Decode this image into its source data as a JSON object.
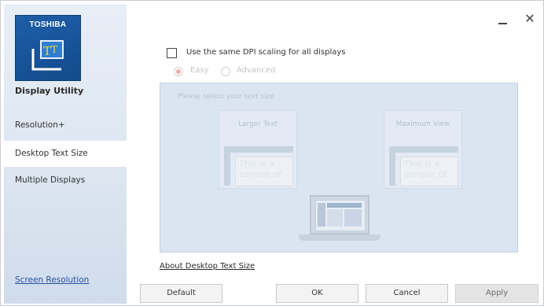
{
  "sidebar": {
    "brand": "TOSHIBA",
    "logo_glyph": "T",
    "app_name": "Display Utility",
    "items": [
      {
        "label": "Resolution+"
      },
      {
        "label": "Desktop Text Size"
      },
      {
        "label": "Multiple Displays"
      }
    ],
    "active_item": "Desktop Text Size",
    "bottom_link": "Screen Resolution"
  },
  "window_controls": {
    "minimize": "minimize-icon",
    "close_glyph": "✕"
  },
  "main": {
    "checkbox_label": "Use the same DPI scaling for all displays",
    "checkbox_checked": false,
    "radio_easy": "Easy",
    "radio_advanced": "Advanced",
    "radio_selected": "Easy",
    "panel_hint": "Please select your text size",
    "card_larger": {
      "title": "Larger Text",
      "sample": "This is a sample of"
    },
    "card_max": {
      "title": "Maximum View",
      "sample": "This is a sample of"
    },
    "about_link": "About Desktop Text Size"
  },
  "buttons": {
    "default": "Default",
    "ok": "OK",
    "cancel": "Cancel",
    "apply": "Apply"
  },
  "colors": {
    "brand_blue": "#1e5ea8",
    "link_blue": "#2a4fa3",
    "panel_bg": "#dbe5f1"
  }
}
